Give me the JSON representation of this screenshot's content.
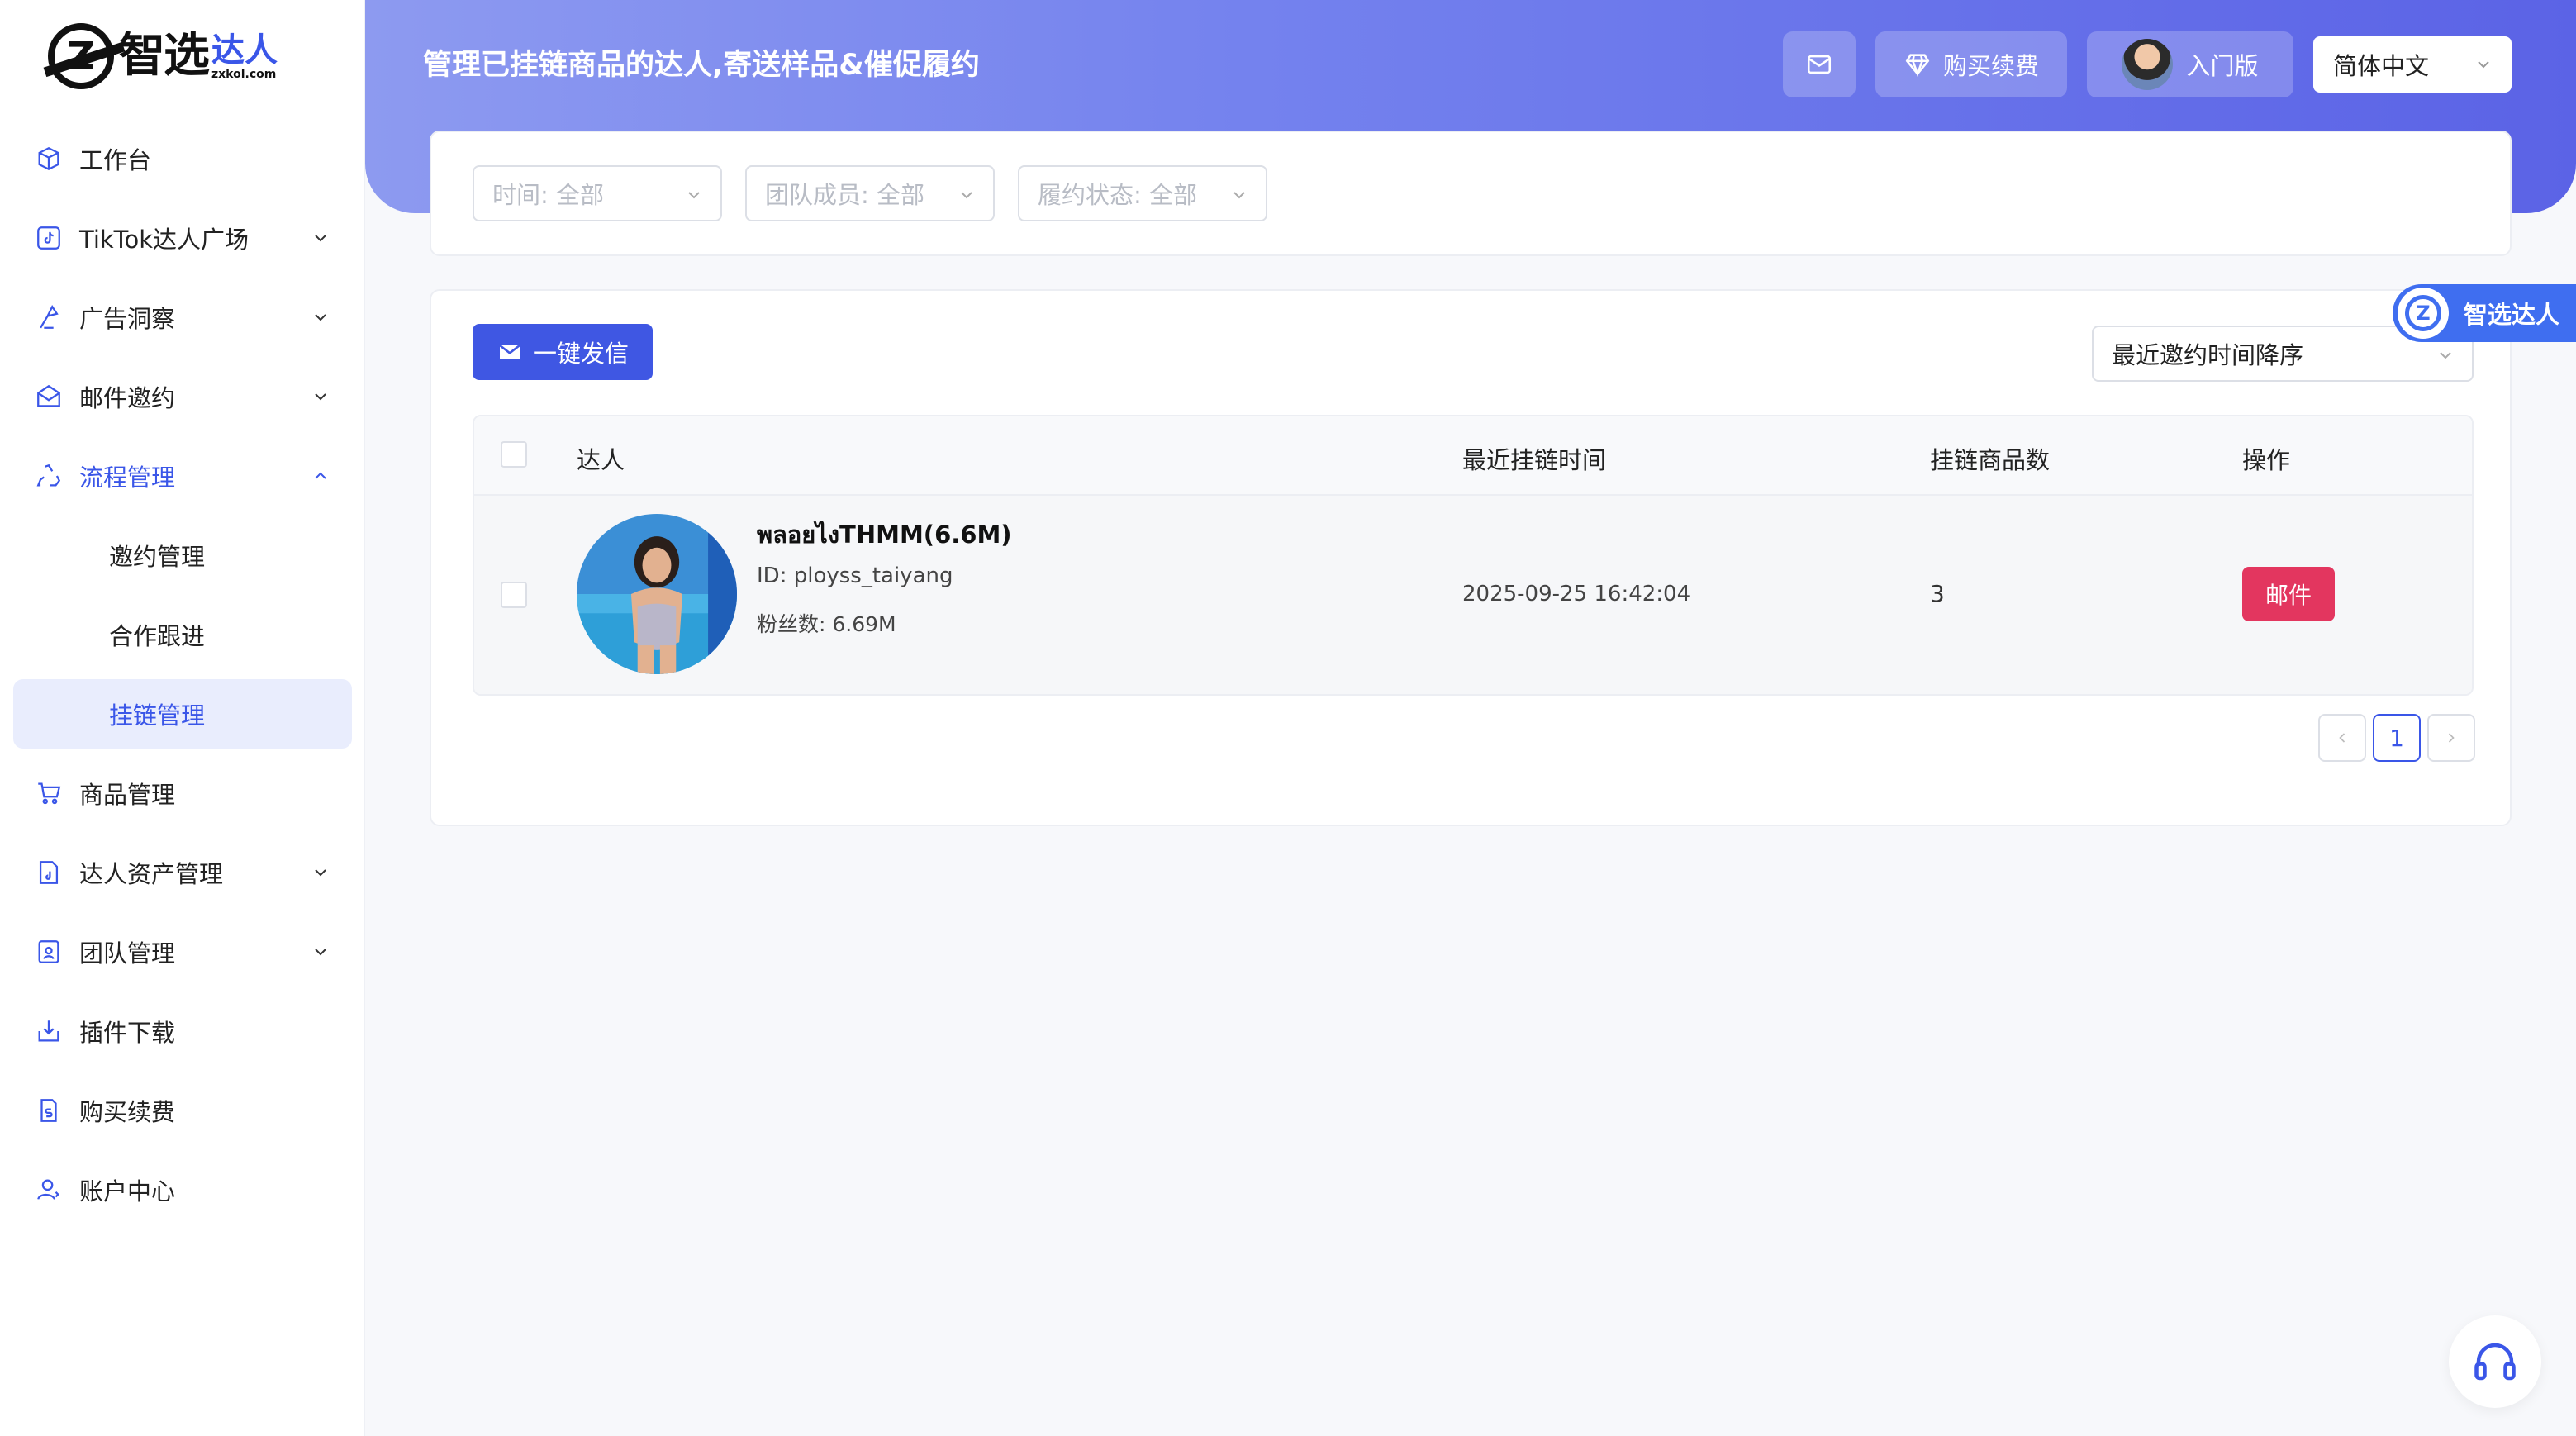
{
  "brand": {
    "logo_letter": "Z",
    "name_main": "智选",
    "name_accent": "达人",
    "url": "zxkol.com",
    "accent_color": "#3a56e8"
  },
  "sidebar": {
    "items": [
      {
        "label": "工作台",
        "icon": "cube-icon"
      },
      {
        "label": "TikTok达人广场",
        "icon": "tiktok-icon"
      },
      {
        "label": "广告洞察",
        "icon": "insight-icon"
      },
      {
        "label": "邮件邀约",
        "icon": "mail-open-icon"
      },
      {
        "label": "流程管理",
        "icon": "recycle-icon"
      },
      {
        "label": "邀约管理"
      },
      {
        "label": "合作跟进"
      },
      {
        "label": "挂链管理"
      },
      {
        "label": "商品管理",
        "icon": "cart-icon"
      },
      {
        "label": "达人资产管理",
        "icon": "asset-icon"
      },
      {
        "label": "团队管理",
        "icon": "team-icon"
      },
      {
        "label": "插件下载",
        "icon": "download-icon"
      },
      {
        "label": "购买续费",
        "icon": "renew-icon"
      },
      {
        "label": "账户中心",
        "icon": "user-icon"
      }
    ]
  },
  "header": {
    "title": "管理已挂链商品的达人,寄送样品&催促履约",
    "buy_label": "购买续费",
    "plan_label": "入门版",
    "language": "简体中文"
  },
  "filters": {
    "time": "时间: 全部",
    "member": "团队成员: 全部",
    "status": "履约状态: 全部"
  },
  "actions": {
    "send_all": "一键发信",
    "sort": "最近邀约时间降序"
  },
  "table": {
    "columns": [
      "达人",
      "最近挂链时间",
      "挂链商品数",
      "操作"
    ],
    "rows": [
      {
        "name": "พลอยไงTHMM(6.6M)",
        "id": "ID: ployss_taiyang",
        "fans": "粉丝数: 6.69M",
        "time": "2025-09-25 16:42:04",
        "count": "3",
        "action": "邮件"
      }
    ]
  },
  "pagination": {
    "current": "1"
  },
  "float_widget": {
    "label": "智选达人"
  },
  "colors": {
    "primary": "#3f57e3",
    "danger": "#e3365f"
  }
}
